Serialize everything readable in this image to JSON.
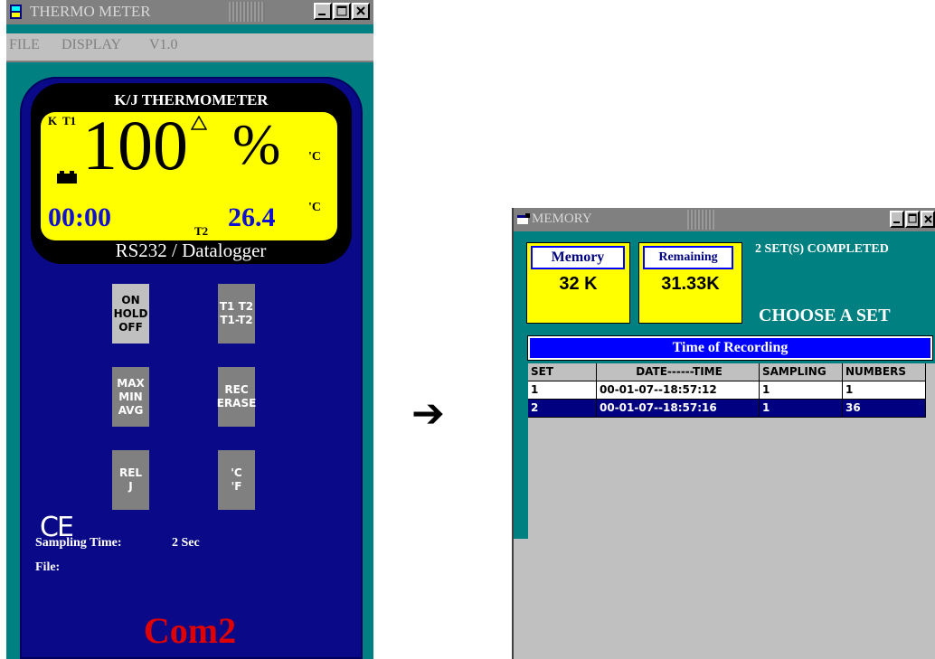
{
  "thermo_window": {
    "title": "THERMO METER",
    "menu": [
      "FILE",
      "DISPLAY",
      "V1.0"
    ],
    "lcd": {
      "title": "K/J THERMOMETER",
      "type_label": "K",
      "channel_label": "T1",
      "main_value": "100",
      "main_unit": "%",
      "unit_top": "'C",
      "unit_bottom": "'C",
      "time": "00:00",
      "channel2_label": "T2",
      "t2_value": "26.4"
    },
    "subtitle": "RS232 / Datalogger",
    "buttons": [
      {
        "lines": [
          "ON",
          "HOLD",
          "OFF"
        ]
      },
      {
        "lines": [
          "T1 T2",
          "T1-T2"
        ]
      },
      {
        "lines": [
          "MAX",
          "MIN",
          "AVG"
        ]
      },
      {
        "lines": [
          "REC",
          "ERASE"
        ]
      },
      {
        "lines": [
          "REL",
          "J"
        ]
      },
      {
        "lines": [
          "'C",
          "'F"
        ]
      }
    ],
    "ce_mark": "CE",
    "sampling_label": "Sampling Time:",
    "sampling_value": "2 Sec",
    "file_label": "File:",
    "port": "Com2"
  },
  "memory_window": {
    "title": "MEMORY",
    "memory_label": "Memory",
    "memory_value": "32 K",
    "remaining_label": "Remaining",
    "remaining_value": "31.33K",
    "status": "2 SET(S) COMPLETED",
    "prompt": "CHOOSE A SET",
    "table_title": "Time of Recording",
    "columns": [
      "SET",
      "DATE------TIME",
      "SAMPLING",
      "NUMBERS"
    ],
    "rows": [
      [
        "1",
        "00-01-07--18:57:12",
        "1",
        "1"
      ],
      [
        "2",
        "00-01-07--18:57:16",
        "1",
        "36"
      ]
    ]
  },
  "colors": {
    "window_teal": "#008080",
    "device_blue": "#0a0a88",
    "lcd_yellow": "#ffff00",
    "port_red": "#e00000",
    "selected_row": "#000080"
  }
}
